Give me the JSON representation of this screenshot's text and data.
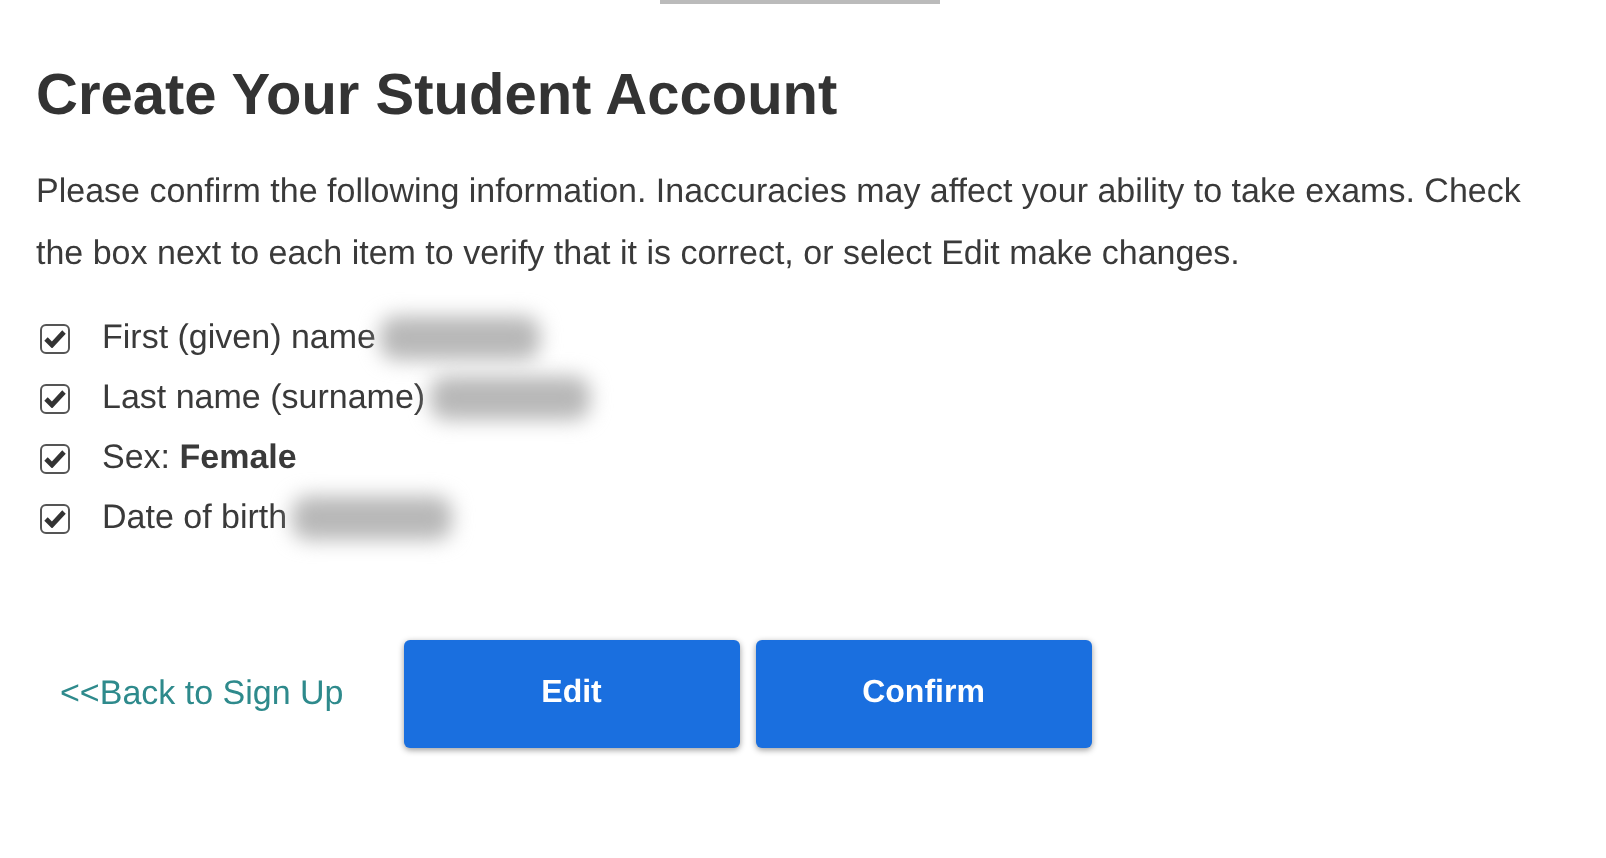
{
  "title": "Create Your Student Account",
  "intro": "Please confirm the following information. Inaccuracies may affect your ability to take exams. Check the box next to each item to verify that it is correct, or select Edit make changes.",
  "items": [
    {
      "label": "First (given) name",
      "checked": true,
      "redacted": true
    },
    {
      "label": "Last name (surname)",
      "checked": true,
      "redacted": true
    },
    {
      "label": "Sex: **Female**",
      "checked": true,
      "redacted": false
    },
    {
      "label": "Date of birth",
      "checked": true,
      "redacted": true
    }
  ],
  "back_link": "<<Back to Sign Up",
  "buttons": [
    "Edit",
    "Confirm"
  ]
}
